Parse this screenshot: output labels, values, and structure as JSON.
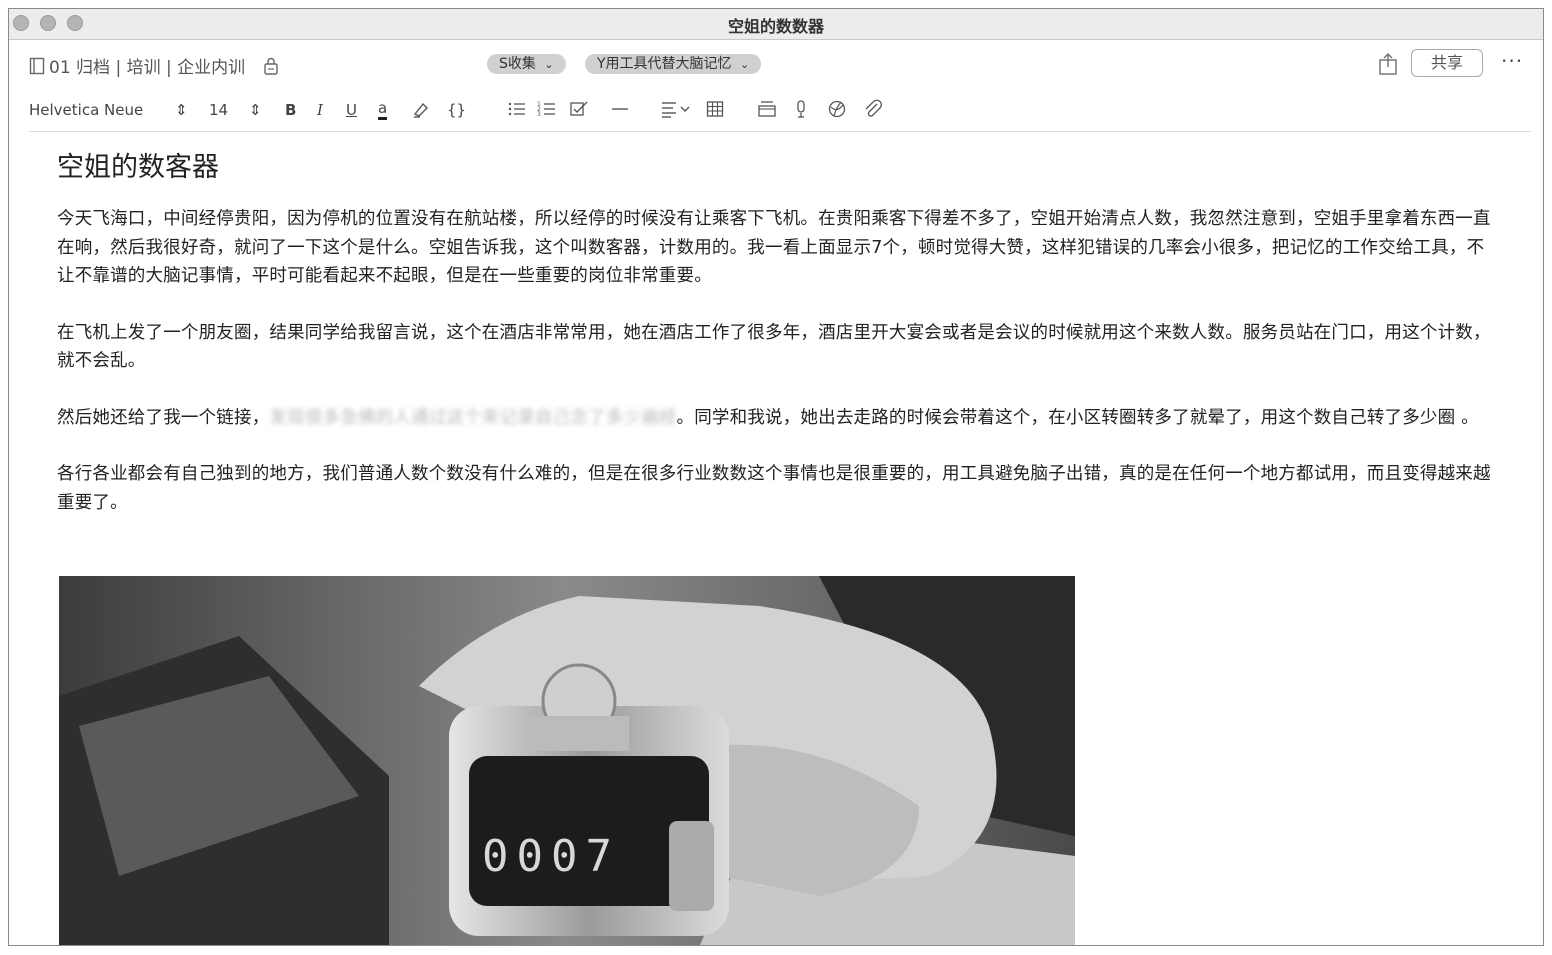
{
  "window": {
    "title": "空姐的数数器"
  },
  "notebar": {
    "breadcrumb": "01 归档 | 培训 | 企业内训",
    "tags": [
      {
        "label": "S收集"
      },
      {
        "label": "Y用工具代替大脑记忆"
      }
    ],
    "share_label": "共享",
    "more_label": "···"
  },
  "toolbar": {
    "font_name": "Helvetica Neue",
    "font_size": "14",
    "bold_label": "B",
    "italic_label": "I",
    "underline_label": "U",
    "color_label": "a",
    "code_label": "{}"
  },
  "document": {
    "title": "空姐的数客器",
    "paragraphs": [
      "今天飞海口，中间经停贵阳，因为停机的位置没有在航站楼，所以经停的时候没有让乘客下飞机。在贵阳乘客下得差不多了，空姐开始清点人数，我忽然注意到，空姐手里拿着东西一直在响，然后我很好奇，就问了一下这个是什么。空姐告诉我，这个叫数客器，计数用的。我一看上面显示7个，顿时觉得大赞，这样犯错误的几率会小很多，把记忆的工作交给工具，不让不靠谱的大脑记事情，平时可能看起来不起眼，但是在一些重要的岗位非常重要。",
      "在飞机上发了一个朋友圈，结果同学给我留言说，这个在酒店非常常用，她在酒店工作了很多年，酒店里开大宴会或者是会议的时候就用这个来数人数。服务员站在门口，用这个计数，就不会乱。",
      "各行各业都会有自己独到的地方，我们普通人数个数没有什么难的，但是在很多行业数数这个事情也是很重要的，用工具避免脑子出错，真的是在任何一个地方都试用，而且变得越来越重要了。"
    ],
    "para3_before": "然后她还给了我一个链接，",
    "para3_link_blurred": "发现很多急佛的人通过这个来记录自己念了多少遍经",
    "para3_after": "。同学和我说，她出去走路的时候会带着这个，在小区转圈转多了就晕了，用这个数自己转了多少圈 。",
    "photo_counter_reading": "0007"
  }
}
